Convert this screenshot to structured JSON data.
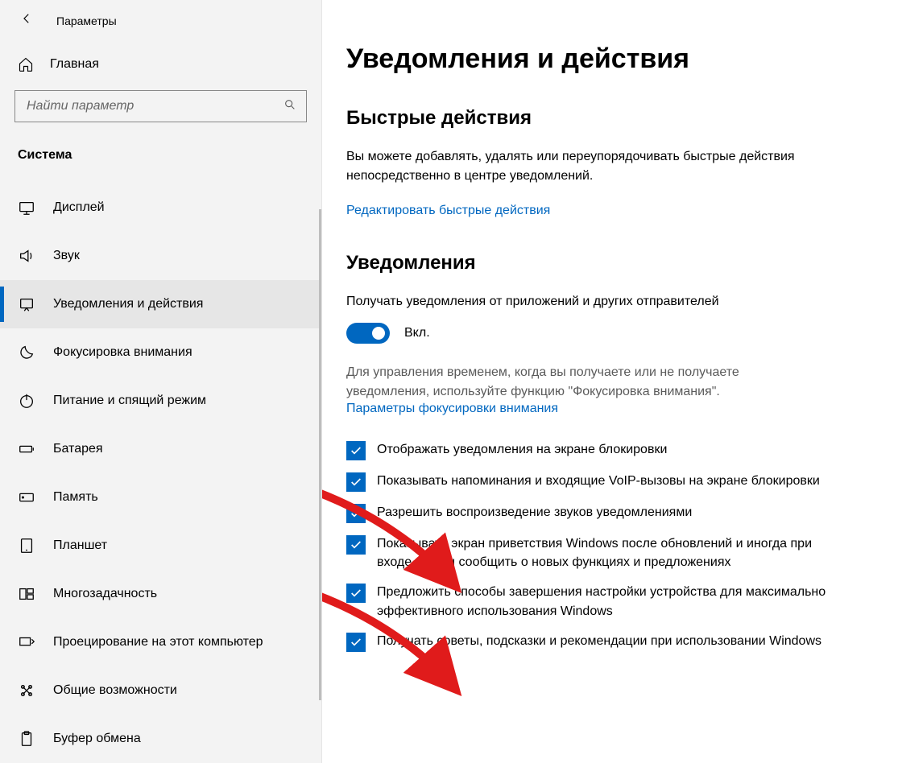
{
  "header": {
    "title": "Параметры"
  },
  "home_label": "Главная",
  "search": {
    "placeholder": "Найти параметр"
  },
  "section_label": "Система",
  "nav": [
    {
      "id": "display",
      "label": "Дисплей",
      "selected": false
    },
    {
      "id": "sound",
      "label": "Звук",
      "selected": false
    },
    {
      "id": "notifications",
      "label": "Уведомления и действия",
      "selected": true
    },
    {
      "id": "focus",
      "label": "Фокусировка внимания",
      "selected": false
    },
    {
      "id": "power",
      "label": "Питание и спящий режим",
      "selected": false
    },
    {
      "id": "battery",
      "label": "Батарея",
      "selected": false
    },
    {
      "id": "storage",
      "label": "Память",
      "selected": false
    },
    {
      "id": "tablet",
      "label": "Планшет",
      "selected": false
    },
    {
      "id": "multitask",
      "label": "Многозадачность",
      "selected": false
    },
    {
      "id": "projecting",
      "label": "Проецирование на этот компьютер",
      "selected": false
    },
    {
      "id": "shared",
      "label": "Общие возможности",
      "selected": false
    },
    {
      "id": "clipboard",
      "label": "Буфер обмена",
      "selected": false
    }
  ],
  "main": {
    "page_title": "Уведомления и действия",
    "quick": {
      "heading": "Быстрые действия",
      "desc": "Вы можете добавлять, удалять или переупорядочивать быстрые действия непосредственно в центре уведомлений.",
      "link": "Редактировать быстрые действия"
    },
    "notifications": {
      "heading": "Уведомления",
      "toggle_label": "Получать уведомления от приложений и других отправителей",
      "toggle_state": "Вкл.",
      "focus_desc": "Для управления временем, когда вы получаете или не получаете уведомления, используйте функцию \"Фокусировка внимания\".",
      "focus_link": "Параметры фокусировки внимания",
      "checks": [
        "Отображать уведомления на экране блокировки",
        "Показывать напоминания и входящие VoIP-вызовы на экране блокировки",
        "Разрешить  воспроизведение звуков уведомлениями",
        "Показывать экран приветствия Windows после обновлений и иногда при входе, чтобы сообщить о новых функциях и предложениях",
        "Предложить способы завершения настройки устройства для максимально эффективного использования Windows",
        "Получать советы, подсказки и рекомендации при использовании Windows"
      ]
    }
  }
}
